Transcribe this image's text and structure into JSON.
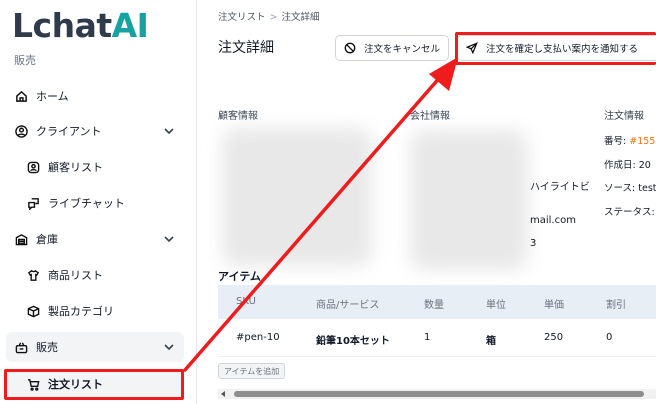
{
  "brand": {
    "logo_main": "Lchat",
    "logo_accent": "AI",
    "accent_color": "#17a2a2"
  },
  "sidebar": {
    "section_label": "販売",
    "items": [
      {
        "label": "ホーム",
        "icon": "home-icon"
      },
      {
        "label": "クライアント",
        "icon": "user-circle-icon",
        "expandable": true
      },
      {
        "label": "顧客リスト",
        "icon": "user-badge-icon"
      },
      {
        "label": "ライブチャット",
        "icon": "chat-icon"
      },
      {
        "label": "倉庫",
        "icon": "warehouse-icon",
        "expandable": true
      },
      {
        "label": "商品リスト",
        "icon": "shirt-icon"
      },
      {
        "label": "製品カテゴリ",
        "icon": "box-icon"
      },
      {
        "label": "販売",
        "icon": "basket-icon",
        "expandable": true
      },
      {
        "label": "注文リスト",
        "icon": "cart-icon",
        "selected": true
      }
    ]
  },
  "breadcrumb": {
    "parent": "注文リスト",
    "separator": ">",
    "current": "注文詳細"
  },
  "page": {
    "title": "注文詳細"
  },
  "actions": {
    "cancel_label": "注文をキャンセル",
    "confirm_label": "注文を確定し支払い案内を通知する"
  },
  "sections": {
    "customer": "顧客情報",
    "company": "会社情報",
    "order": "注文情報"
  },
  "company_visible": {
    "name_fragment": "ハイライトビ",
    "email_fragment": "mail.com",
    "digit_fragment": "3"
  },
  "order_info": {
    "number_label": "番号:",
    "number_value": "#155",
    "created_label": "作成日:",
    "created_value": "20",
    "source_label": "ソース:",
    "source_value": "test",
    "status_label": "ステータス:"
  },
  "items_section": {
    "title_fragment": "アイテム"
  },
  "table": {
    "headers": [
      "SKU",
      "商品/サービス",
      "数量",
      "単位",
      "単価",
      "割引"
    ],
    "rows": [
      [
        "#pen-10",
        "鉛筆10本セット",
        "1",
        "箱",
        "250",
        "0"
      ]
    ]
  },
  "add_item_label": "アイテムを追加",
  "annotation_color": "#ee1c1c"
}
